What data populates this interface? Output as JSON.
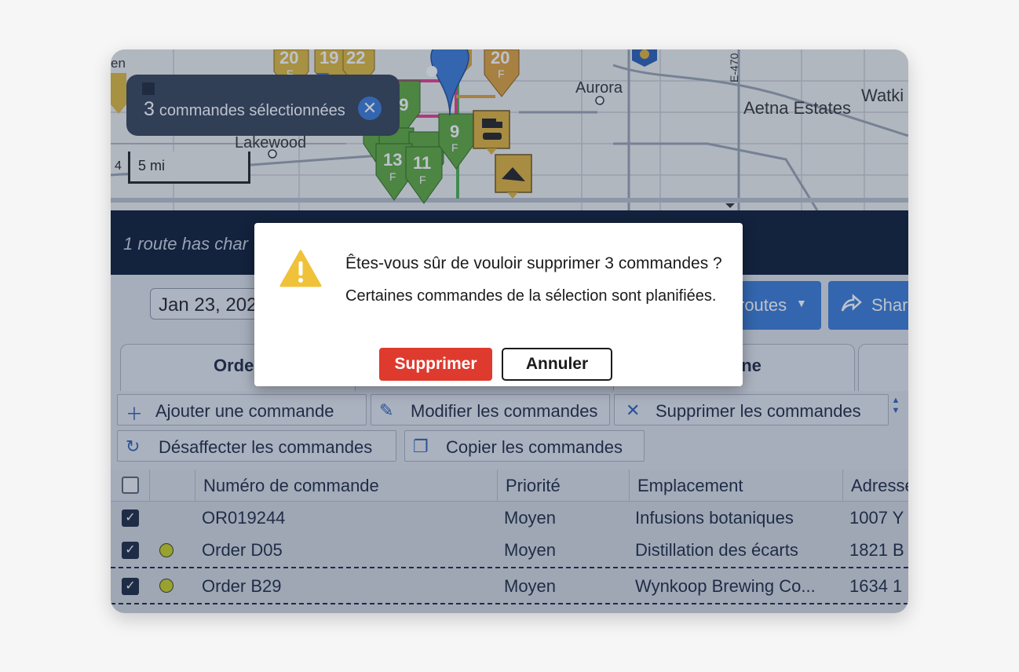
{
  "map": {
    "labels": {
      "lakewood": "Lakewood",
      "aurora": "Aurora",
      "aetna": "Aetna Estates",
      "watkins": "Watki",
      "en": "en",
      "e470": "E-470"
    },
    "scale": {
      "value": "5 mi",
      "left_num": "4"
    },
    "selection": {
      "count": "3",
      "text": "commandes sélectionnées"
    },
    "pins": [
      {
        "num": "20",
        "sub": "F",
        "color": "#e0b93a"
      },
      {
        "num": "19",
        "sub": "",
        "color": "#e0b93a"
      },
      {
        "num": "22",
        "sub": "",
        "color": "#e0b93a"
      },
      {
        "num": "19",
        "sub": "",
        "color": "#5fa83c"
      },
      {
        "num": "20",
        "sub": "F",
        "color": "#e0a23a"
      },
      {
        "num": "9",
        "sub": "F",
        "color": "#5fa83c"
      },
      {
        "num": "13",
        "sub": "F",
        "color": "#5fa83c"
      },
      {
        "num": "11",
        "sub": "F",
        "color": "#5fa83c"
      }
    ]
  },
  "banner": {
    "text": "1 route has char"
  },
  "toolbar": {
    "date": "Jan 23, 2024",
    "routes_btn": "routes",
    "share_btn": "Shar",
    "tabs": [
      "Orde",
      "line"
    ]
  },
  "actions": {
    "add": "Ajouter une commande",
    "edit": "Modifier les commandes",
    "delete": "Supprimer les commandes",
    "unassign": "Désaffecter les commandes",
    "copy": "Copier les commandes"
  },
  "table": {
    "headers": [
      "Numéro de commande",
      "Priorité",
      "Emplacement",
      "Adresse"
    ],
    "rows": [
      {
        "order": "OR019244",
        "priority": "Moyen",
        "location": "Infusions botaniques",
        "address": "1007 Y"
      },
      {
        "order": "Order D05",
        "priority": "Moyen",
        "location": "Distillation des écarts",
        "address": "1821 B"
      },
      {
        "order": "Order B29",
        "priority": "Moyen",
        "location": "Wynkoop Brewing Co...",
        "address": "1634 1"
      }
    ]
  },
  "dialog": {
    "question": "Êtes-vous sûr de vouloir supprimer 3 commandes ?",
    "detail": "Certaines commandes de la sélection sont planifiées.",
    "confirm": "Supprimer",
    "cancel": "Annuler"
  },
  "colors": {
    "accent": "#3a7bd5",
    "danger": "#df3a2e",
    "warning": "#f0c23a",
    "banner": "#0c1a33"
  }
}
